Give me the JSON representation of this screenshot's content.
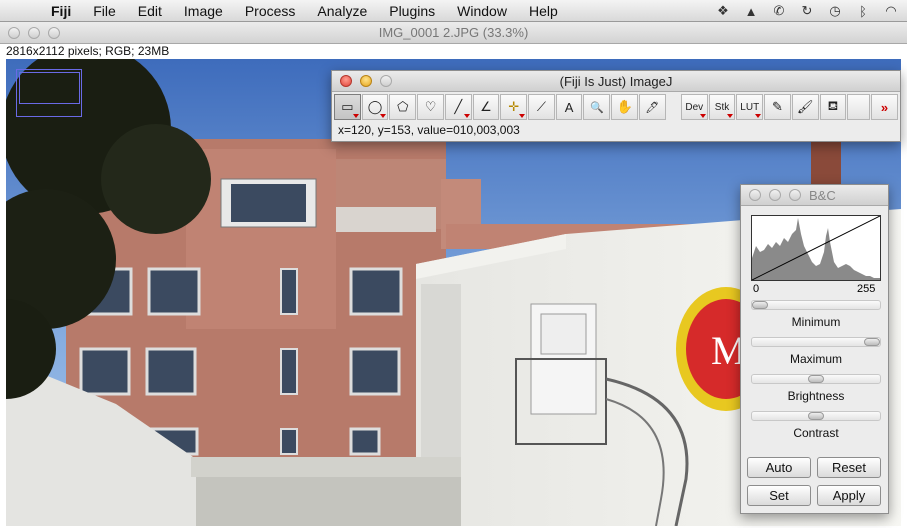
{
  "menubar": {
    "app": "Fiji",
    "items": [
      "File",
      "Edit",
      "Image",
      "Process",
      "Analyze",
      "Plugins",
      "Window",
      "Help"
    ]
  },
  "image_window": {
    "title": "IMG_0001 2.JPG (33.3%)",
    "info": "2816x2112 pixels; RGB; 23MB"
  },
  "toolbar": {
    "title": "(Fiji Is Just) ImageJ",
    "tools": [
      {
        "name": "rectangle-tool",
        "glyph": "▭"
      },
      {
        "name": "oval-tool",
        "glyph": "◯"
      },
      {
        "name": "polygon-tool",
        "glyph": "⬠"
      },
      {
        "name": "freehand-tool",
        "glyph": "♡"
      },
      {
        "name": "line-tool",
        "glyph": "╱"
      },
      {
        "name": "angle-tool",
        "glyph": "∠"
      },
      {
        "name": "point-tool",
        "glyph": "✛"
      },
      {
        "name": "wand-tool",
        "glyph": "⟋"
      },
      {
        "name": "text-tool",
        "glyph": "A"
      },
      {
        "name": "magnifier-tool",
        "glyph": "🔍"
      },
      {
        "name": "scroll-tool",
        "glyph": "✋"
      },
      {
        "name": "color-picker-tool",
        "glyph": "🖊"
      }
    ],
    "dev": "Dev",
    "stk": "Stk",
    "lut": "LUT",
    "more": "»",
    "status": "x=120, y=153, value=010,003,003"
  },
  "bc": {
    "title": "B&C",
    "hist_min": "0",
    "hist_max": "255",
    "minimum_label": "Minimum",
    "maximum_label": "Maximum",
    "brightness_label": "Brightness",
    "contrast_label": "Contrast",
    "minimum_level": 0,
    "maximum_level": 1,
    "brightness_level": 0.5,
    "contrast_level": 0.5,
    "buttons": {
      "auto": "Auto",
      "reset": "Reset",
      "set": "Set",
      "apply": "Apply"
    }
  }
}
